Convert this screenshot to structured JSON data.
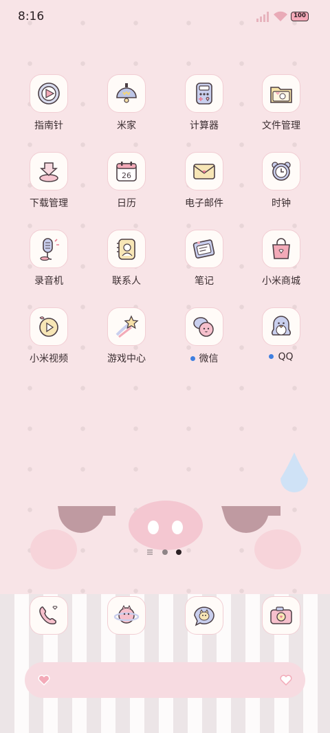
{
  "status_bar": {
    "time": "8:16",
    "battery": "100"
  },
  "apps": [
    {
      "label": "指南针",
      "icon": "compass-icon"
    },
    {
      "label": "米家",
      "icon": "mijia-icon"
    },
    {
      "label": "计算器",
      "icon": "calculator-icon"
    },
    {
      "label": "文件管理",
      "icon": "folder-icon"
    },
    {
      "label": "下载管理",
      "icon": "download-icon"
    },
    {
      "label": "日历",
      "icon": "calendar-icon",
      "day": "26"
    },
    {
      "label": "电子邮件",
      "icon": "mail-icon"
    },
    {
      "label": "时钟",
      "icon": "clock-icon"
    },
    {
      "label": "录音机",
      "icon": "recorder-icon"
    },
    {
      "label": "联系人",
      "icon": "contacts-icon"
    },
    {
      "label": "笔记",
      "icon": "notes-icon"
    },
    {
      "label": "小米商城",
      "icon": "shop-bag-icon"
    },
    {
      "label": "小米视频",
      "icon": "video-play-icon"
    },
    {
      "label": "游戏中心",
      "icon": "shooting-star-icon"
    },
    {
      "label": "微信",
      "icon": "wechat-icon",
      "new_badge": true
    },
    {
      "label": "QQ",
      "icon": "qq-penguin-icon",
      "new_badge": true
    }
  ],
  "dock": [
    {
      "icon": "phone-icon"
    },
    {
      "icon": "browser-planet-icon"
    },
    {
      "icon": "messages-icon"
    },
    {
      "icon": "camera-icon"
    }
  ],
  "page_indicator": {
    "pages": 2,
    "current": 2
  },
  "colors": {
    "background": "#f8e4e7",
    "tile_border": "#f1cdd3",
    "badge": "#3f7fe0",
    "search_bar": "#f7dbe1"
  }
}
